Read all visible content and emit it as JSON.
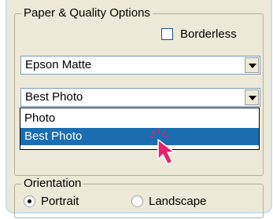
{
  "paper_quality": {
    "group_title": "Paper & Quality Options",
    "borderless_label": "Borderless",
    "borderless_checked": false,
    "media_type": {
      "value": "Epson Matte"
    },
    "quality": {
      "value": "Best Photo",
      "options": [
        "Photo",
        "Best Photo"
      ],
      "highlighted": "Best Photo"
    }
  },
  "orientation": {
    "group_title": "Orientation",
    "options": [
      {
        "label": "Portrait",
        "selected": true
      },
      {
        "label": "Landscape",
        "selected": false
      }
    ]
  },
  "icons": {
    "pointer": "mouse-pointer-icon",
    "dropdown": "chevron-down-icon"
  },
  "colors": {
    "highlight": "#1c6db0",
    "pointer": "#e8216c",
    "panel": "#ece9d8"
  }
}
